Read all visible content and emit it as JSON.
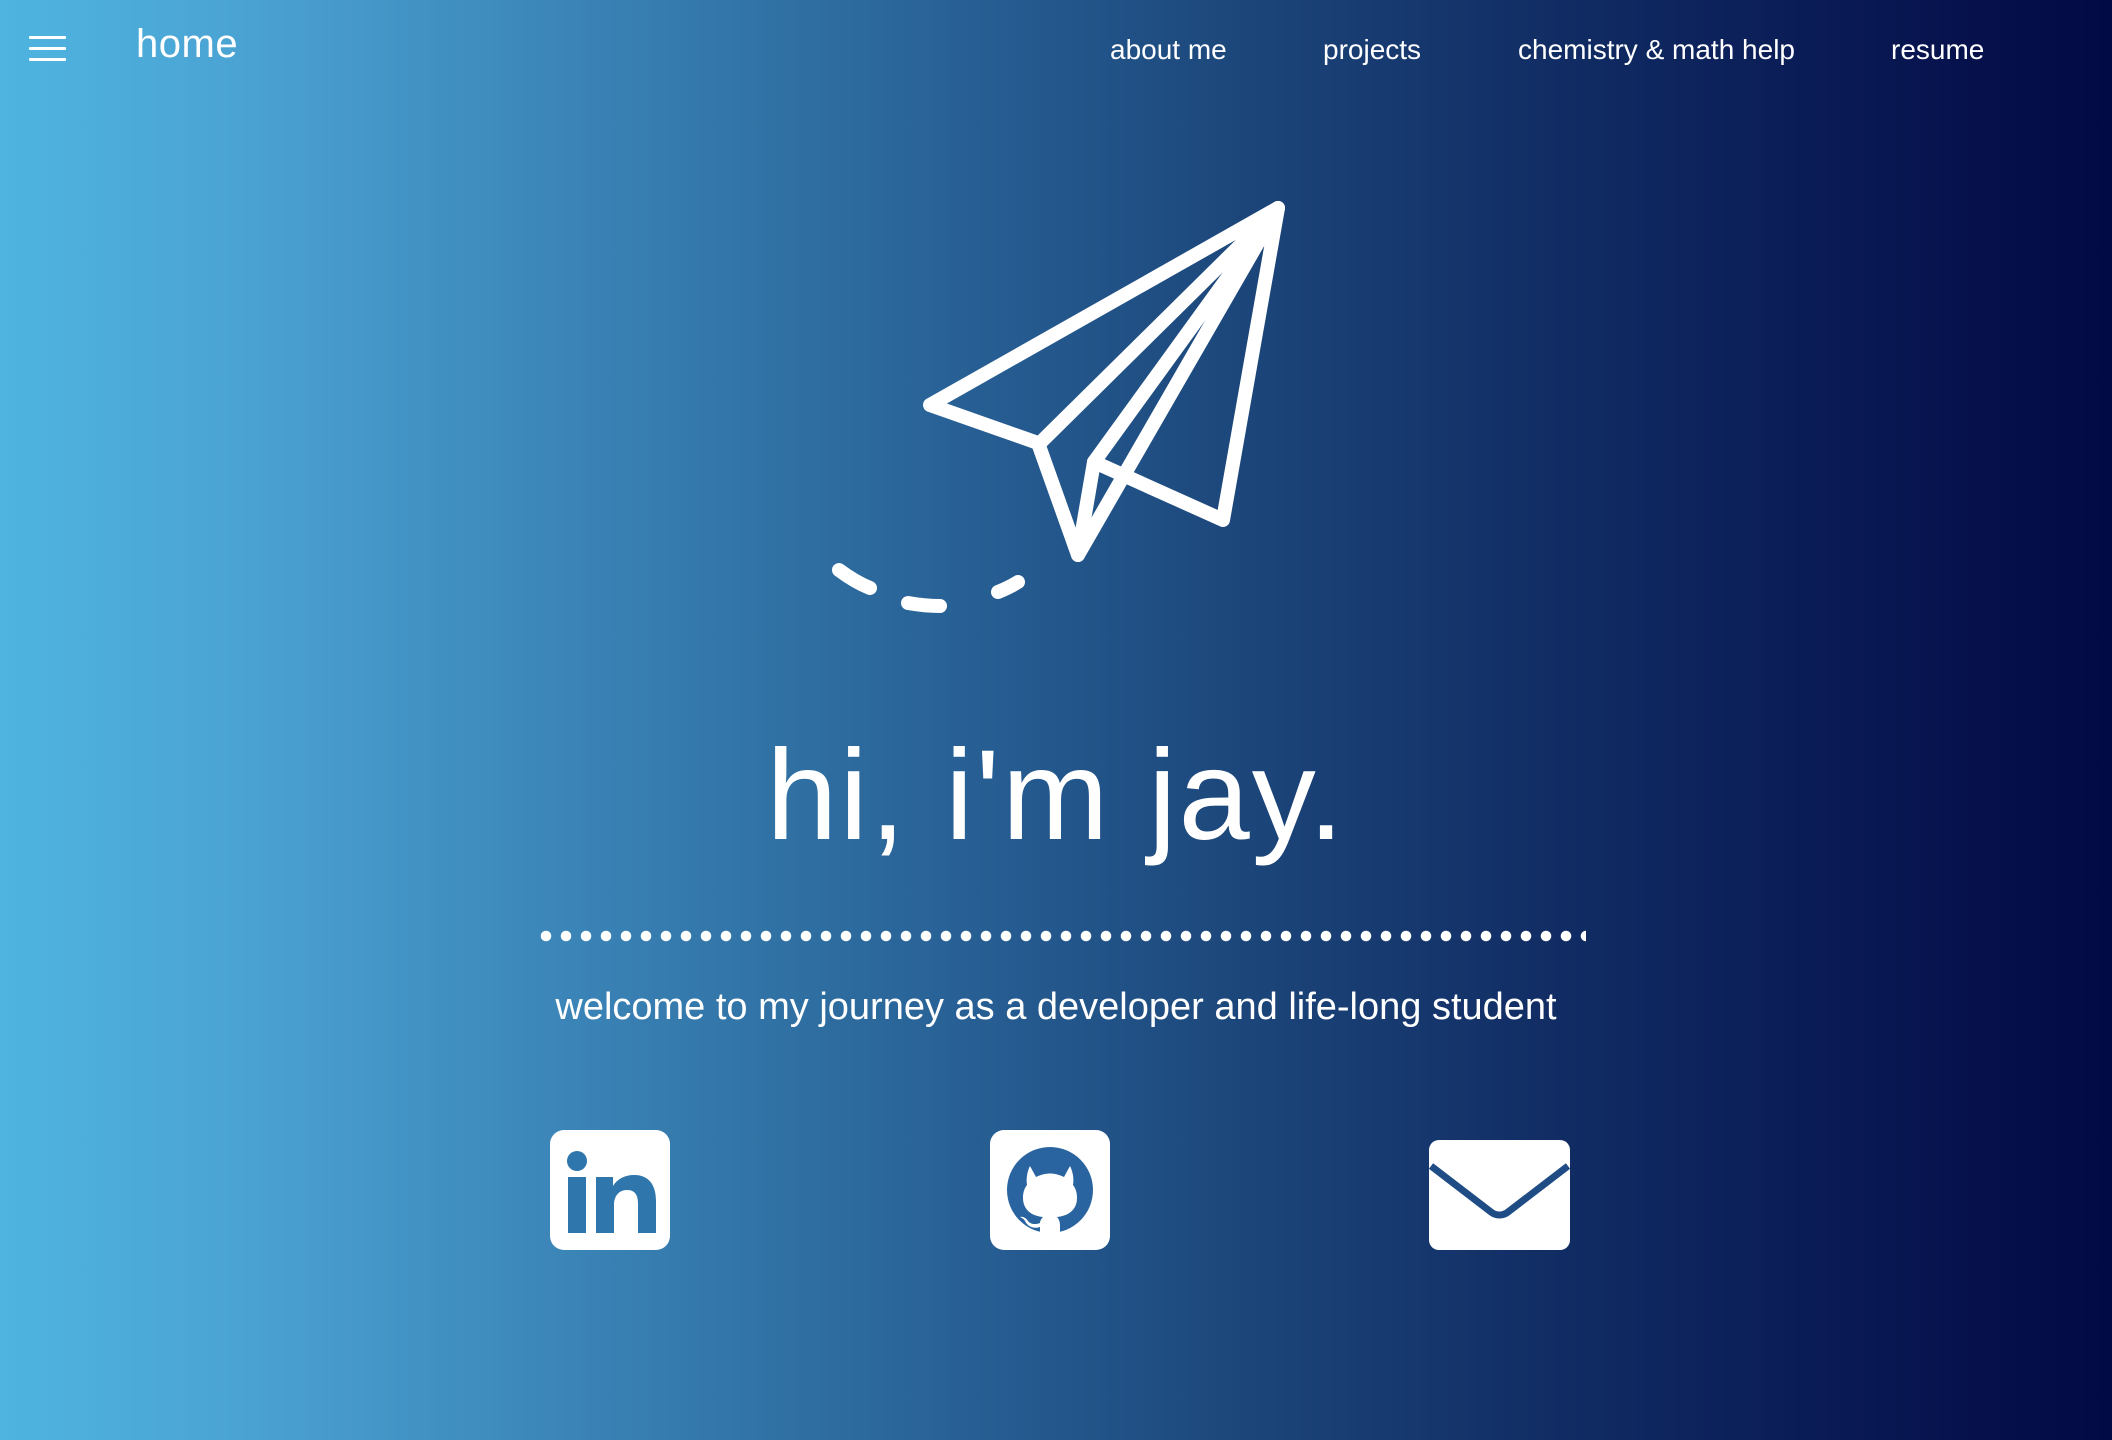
{
  "nav": {
    "menu_icon": "hamburger-menu-icon",
    "brand": "home",
    "links": [
      {
        "label": "about me"
      },
      {
        "label": "projects"
      },
      {
        "label": "chemistry & math help"
      },
      {
        "label": "resume"
      }
    ]
  },
  "hero": {
    "illustration": "paper-plane-icon",
    "title": "hi, i'm jay.",
    "tagline": "welcome to my journey as a developer and life-long student"
  },
  "social": [
    {
      "icon": "linkedin-icon"
    },
    {
      "icon": "github-icon"
    },
    {
      "icon": "email-icon"
    }
  ],
  "colors": {
    "gradient_start": "#4fb4e0",
    "gradient_end": "#020a45",
    "text": "#ffffff"
  }
}
